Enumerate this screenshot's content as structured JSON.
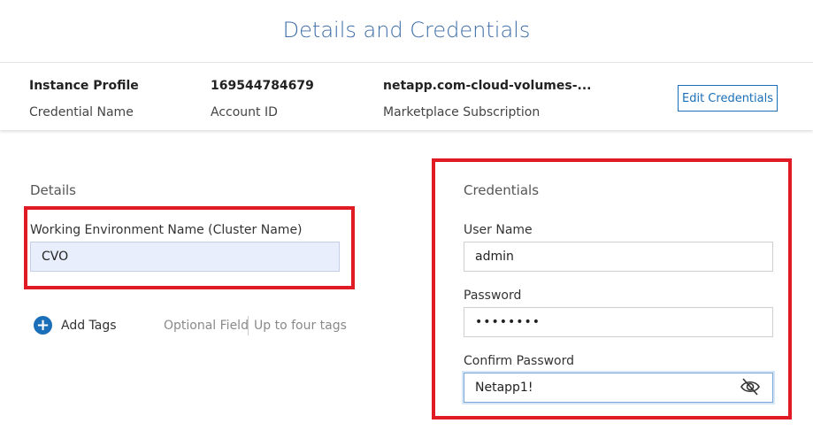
{
  "page_title": "Details and Credentials",
  "summary": {
    "credential_name_value": "Instance Profile",
    "credential_name_label": "Credential Name",
    "account_id_value": "169544784679",
    "account_id_label": "Account ID",
    "marketplace_value": "netapp.com-cloud-volumes-...",
    "marketplace_label": "Marketplace Subscription",
    "edit_button": "Edit Credentials"
  },
  "details": {
    "section_title": "Details",
    "cluster_label": "Working Environment Name (Cluster Name)",
    "cluster_value": "CVO",
    "add_tags_label": "Add Tags",
    "optional_field": "Optional Field",
    "up_to_four_tags": "Up to four tags"
  },
  "credentials": {
    "section_title": "Credentials",
    "user_name_label": "User Name",
    "user_name_value": "admin",
    "password_label": "Password",
    "password_value": "••••••••",
    "confirm_password_label": "Confirm Password",
    "confirm_password_value": "Netapp1!"
  },
  "colors": {
    "accent": "#1a6fb8",
    "title": "#3e6ea8",
    "highlight_box": "#e01b24"
  },
  "icons": {
    "add_tags": "plus-circle-icon",
    "toggle_visibility": "eye-off-icon"
  }
}
